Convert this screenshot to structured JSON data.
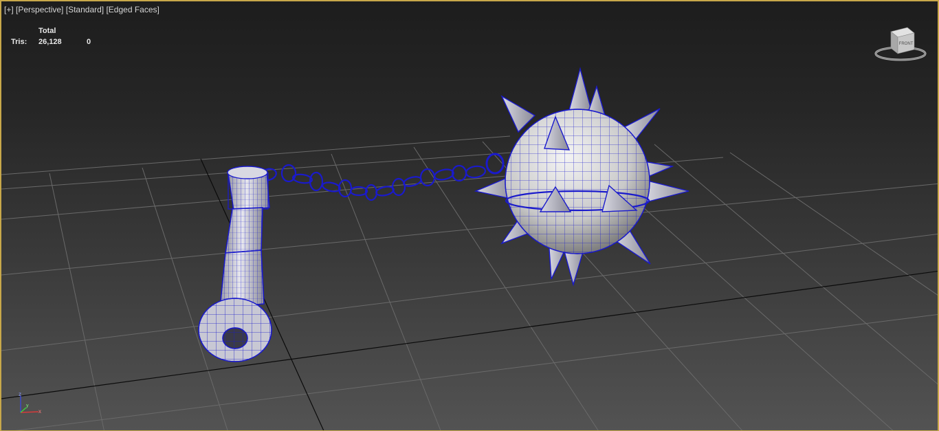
{
  "viewport": {
    "menu_plus": "[+]",
    "view_perspective": "[Perspective]",
    "shading_standard": "[Standard]",
    "shading_edged": "[Edged Faces]"
  },
  "stats": {
    "header": "Total",
    "tris_label": "Tris:",
    "tris_total": "26,128",
    "tris_selected": "0"
  },
  "viewcube": {
    "face_label": "FRONT"
  },
  "axis_gizmo": {
    "x": "x",
    "y": "y",
    "z": "z"
  },
  "colors": {
    "viewport_border": "#c8a84a",
    "wireframe": "#1a1acc",
    "grid_line": "#6a6a6a",
    "grid_axis": "#0a0a0a"
  }
}
